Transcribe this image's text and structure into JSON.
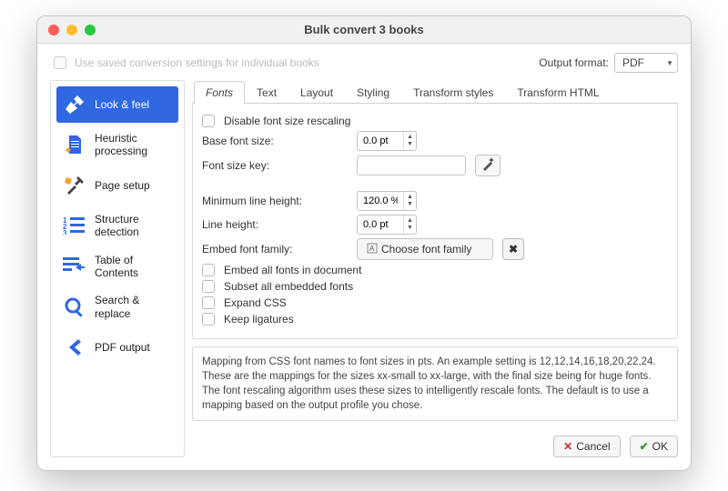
{
  "window": {
    "title": "Bulk convert 3 books"
  },
  "toprow": {
    "use_saved_label": "Use saved conversion settings for individual books",
    "output_format_label": "Output format:",
    "output_format_value": "PDF"
  },
  "sidebar": {
    "items": [
      {
        "label": "Look & feel"
      },
      {
        "label": "Heuristic processing"
      },
      {
        "label": "Page setup"
      },
      {
        "label": "Structure detection"
      },
      {
        "label": "Table of Contents"
      },
      {
        "label": "Search & replace"
      },
      {
        "label": "PDF output"
      }
    ]
  },
  "tabs": [
    {
      "label": "Fonts"
    },
    {
      "label": "Text"
    },
    {
      "label": "Layout"
    },
    {
      "label": "Styling"
    },
    {
      "label": "Transform styles"
    },
    {
      "label": "Transform HTML"
    }
  ],
  "form": {
    "disable_font_rescaling": "Disable font size rescaling",
    "base_font_size_label": "Base font size:",
    "base_font_size_value": "0.0 pt",
    "font_size_key_label": "Font size key:",
    "font_size_key_value": "",
    "min_line_height_label": "Minimum line height:",
    "min_line_height_value": "120.0 %",
    "line_height_label": "Line height:",
    "line_height_value": "0.0 pt",
    "embed_font_family_label": "Embed font family:",
    "choose_font_label": "Choose font family",
    "embed_all_fonts": "Embed all fonts in document",
    "subset_fonts": "Subset all embedded fonts",
    "expand_css": "Expand CSS",
    "keep_ligatures": "Keep ligatures"
  },
  "description": "Mapping from CSS font names to font sizes in pts. An example setting is 12,12,14,16,18,20,22,24. These are the mappings for the sizes xx-small to xx-large, with the final size being for huge fonts. The font rescaling algorithm uses these sizes to intelligently rescale fonts. The default is to use a mapping based on the output profile you chose.",
  "footer": {
    "cancel": "Cancel",
    "ok": "OK"
  }
}
